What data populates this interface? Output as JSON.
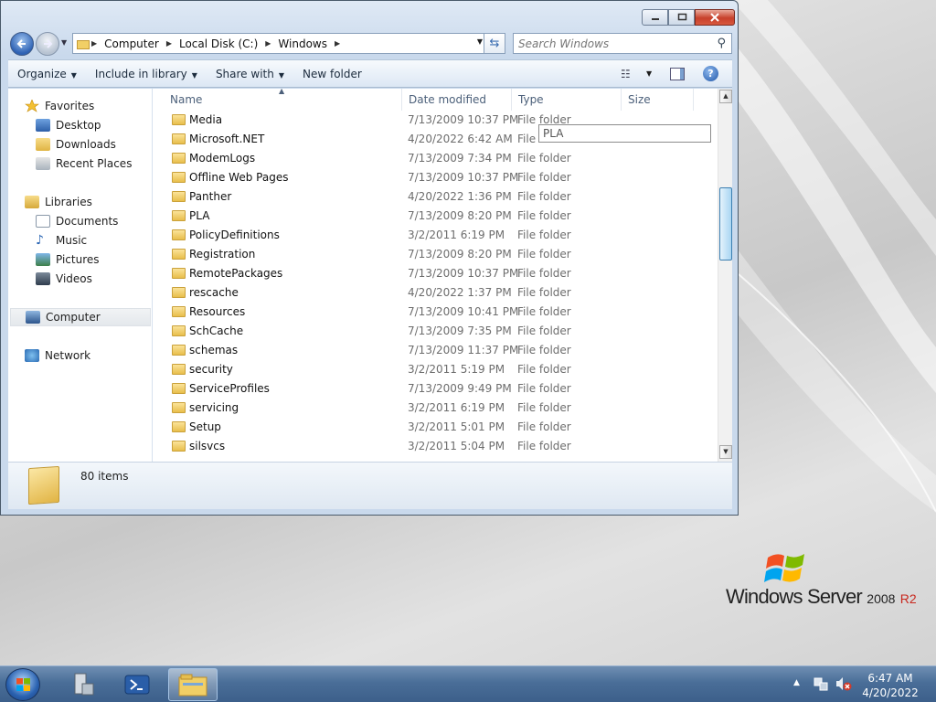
{
  "window": {
    "address_segments": [
      "Computer",
      "Local Disk (C:)",
      "Windows"
    ],
    "search_placeholder": "Search Windows"
  },
  "toolbar": {
    "organize": "Organize",
    "include_in_library": "Include in library",
    "share_with": "Share with",
    "new_folder": "New folder"
  },
  "nav_pane": {
    "favorites": {
      "label": "Favorites",
      "items": [
        "Desktop",
        "Downloads",
        "Recent Places"
      ]
    },
    "libraries": {
      "label": "Libraries",
      "items": [
        "Documents",
        "Music",
        "Pictures",
        "Videos"
      ]
    },
    "computer": "Computer",
    "network": "Network"
  },
  "columns": [
    "Name",
    "Date modified",
    "Type",
    "Size"
  ],
  "rows": [
    {
      "name": "Media",
      "date": "7/13/2009 10:37 PM",
      "type": "File folder"
    },
    {
      "name": "Microsoft.NET",
      "date": "4/20/2022 6:42 AM",
      "type": "File folder"
    },
    {
      "name": "ModemLogs",
      "date": "7/13/2009 7:34 PM",
      "type": "File folder"
    },
    {
      "name": "Offline Web Pages",
      "date": "7/13/2009 10:37 PM",
      "type": "File folder"
    },
    {
      "name": "Panther",
      "date": "4/20/2022 1:36 PM",
      "type": "File folder"
    },
    {
      "name": "PLA",
      "date": "7/13/2009 8:20 PM",
      "type": "File folder"
    },
    {
      "name": "PolicyDefinitions",
      "date": "3/2/2011 6:19 PM",
      "type": "File folder"
    },
    {
      "name": "Registration",
      "date": "7/13/2009 8:20 PM",
      "type": "File folder"
    },
    {
      "name": "RemotePackages",
      "date": "7/13/2009 10:37 PM",
      "type": "File folder"
    },
    {
      "name": "rescache",
      "date": "4/20/2022 1:37 PM",
      "type": "File folder"
    },
    {
      "name": "Resources",
      "date": "7/13/2009 10:41 PM",
      "type": "File folder"
    },
    {
      "name": "SchCache",
      "date": "7/13/2009 7:35 PM",
      "type": "File folder"
    },
    {
      "name": "schemas",
      "date": "7/13/2009 11:37 PM",
      "type": "File folder"
    },
    {
      "name": "security",
      "date": "3/2/2011 5:19 PM",
      "type": "File folder"
    },
    {
      "name": "ServiceProfiles",
      "date": "7/13/2009 9:49 PM",
      "type": "File folder"
    },
    {
      "name": "servicing",
      "date": "3/2/2011 6:19 PM",
      "type": "File folder"
    },
    {
      "name": "Setup",
      "date": "3/2/2011 5:01 PM",
      "type": "File folder"
    },
    {
      "name": "silsvcs",
      "date": "3/2/2011 5:04 PM",
      "type": "File folder"
    }
  ],
  "tooltip": "PLA",
  "status": {
    "count": "80 items"
  },
  "brand": {
    "name": "Windows Server",
    "version": "2008",
    "suffix": "R2"
  },
  "taskbar": {
    "time": "6:47 AM",
    "date": "4/20/2022"
  },
  "colors": {
    "accent": "#2e62b4",
    "taskbar": "#4a6e98",
    "close": "#c7402b"
  }
}
